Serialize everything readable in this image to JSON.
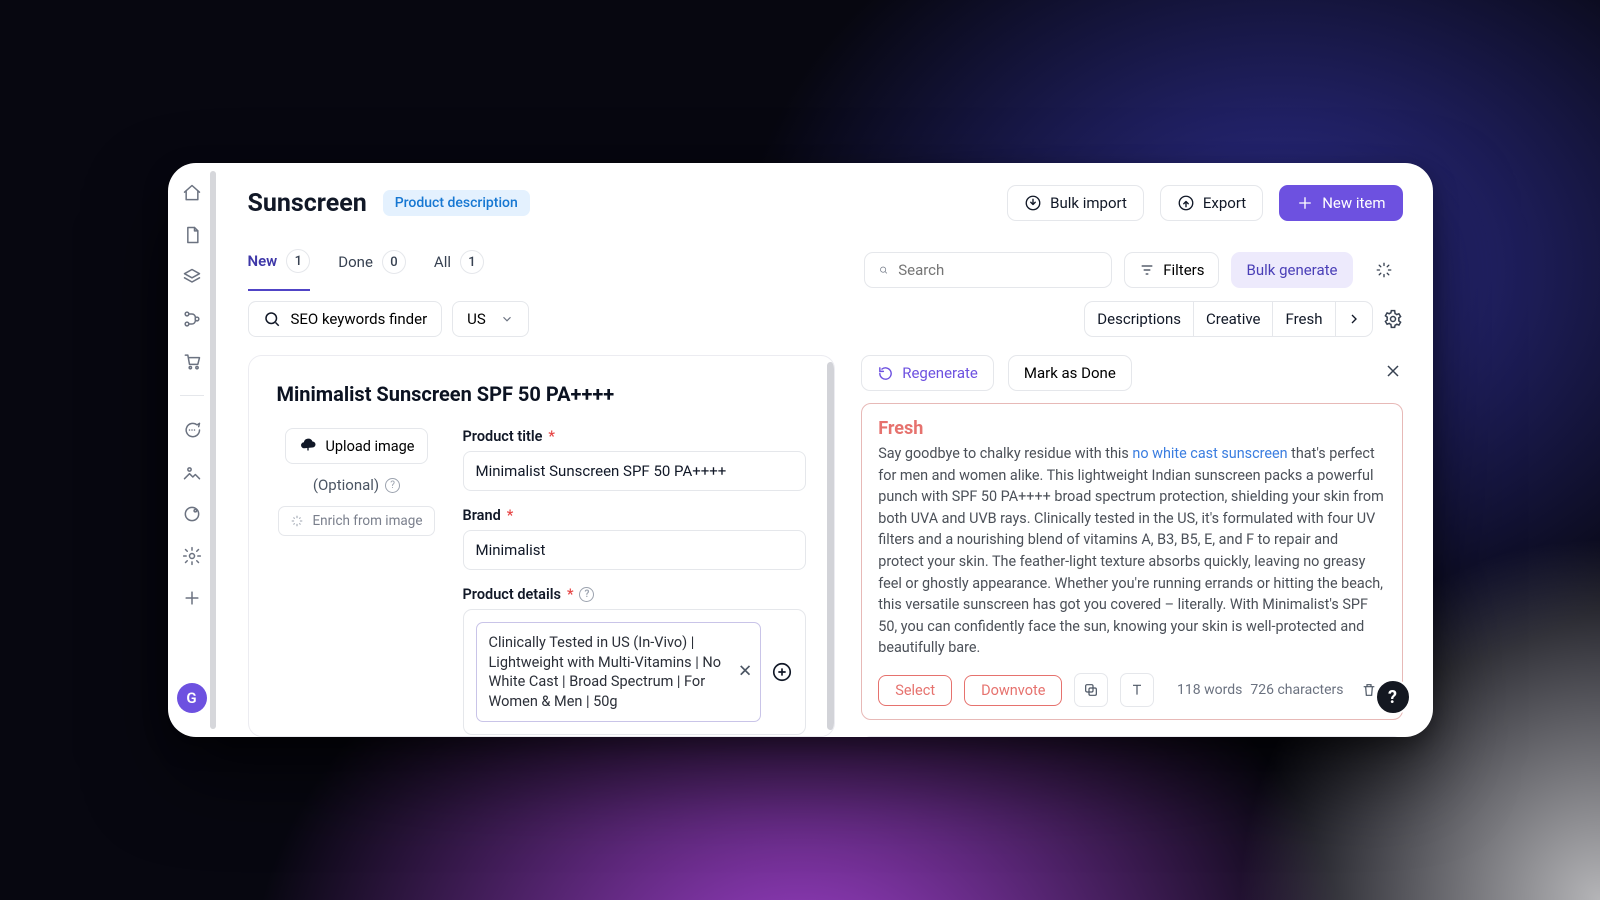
{
  "sidebar": {
    "avatar_initial": "G"
  },
  "header": {
    "title": "Sunscreen",
    "category_chip": "Product description",
    "bulk_import": "Bulk import",
    "export": "Export",
    "new_item": "New item"
  },
  "tabs": {
    "new": {
      "label": "New",
      "count": "1"
    },
    "done": {
      "label": "Done",
      "count": "0"
    },
    "all": {
      "label": "All",
      "count": "1"
    }
  },
  "toolbar": {
    "search_placeholder": "Search",
    "filters": "Filters",
    "bulk_generate": "Bulk generate",
    "seo_finder": "SEO keywords finder",
    "country": "US",
    "chips": {
      "a": "Descriptions",
      "b": "Creative",
      "c": "Fresh"
    }
  },
  "form": {
    "item_title": "Minimalist Sunscreen SPF 50 PA++++",
    "upload_image": "Upload image",
    "optional": "(Optional)",
    "enrich": "Enrich from image",
    "product_title_label": "Product title",
    "product_title_value": "Minimalist Sunscreen SPF 50 PA++++",
    "brand_label": "Brand",
    "brand_value": "Minimalist",
    "details_label": "Product details",
    "details_value": "Clinically Tested in US (In-Vivo) | Lightweight with Multi-Vitamins | No White Cast | Broad Spectrum | For Women & Men | 50g"
  },
  "output": {
    "regenerate": "Regenerate",
    "mark_done": "Mark as Done",
    "variant_title": "Fresh",
    "body_pre": "Say goodbye to chalky residue with this ",
    "body_highlight": "no white cast sunscreen",
    "body_post": " that's perfect for men and women alike. This lightweight Indian sunscreen packs a powerful punch with SPF 50 PA++++ broad spectrum protection, shielding your skin from both UVA and UVB rays. Clinically tested in the US, it's formulated with four UV filters and a nourishing blend of vitamins A, B3, B5, E, and F to repair and protect your skin. The feather-light texture absorbs quickly, leaving no greasy feel or ghostly appearance. Whether you're running errands or hitting the beach, this versatile sunscreen has got you covered – literally. With Minimalist's SPF 50, you can confidently face the sun, knowing your skin is well-protected and beautifully bare.",
    "select": "Select",
    "downvote": "Downvote",
    "words": "118 words",
    "chars": "726 characters",
    "next_variant": "Creative"
  },
  "help": "?"
}
